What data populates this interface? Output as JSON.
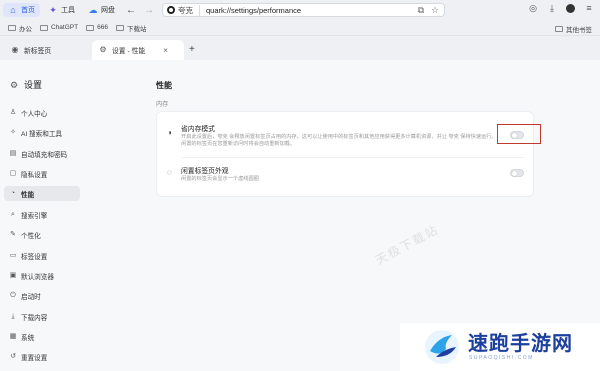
{
  "topbar": {
    "tabs": [
      {
        "label": "首页",
        "icon": "home-icon",
        "active": true
      },
      {
        "label": "工具",
        "icon": "sparkle-icon",
        "active": false
      },
      {
        "label": "网盘",
        "icon": "cloud-icon",
        "active": false
      }
    ],
    "search_engine": "夸克",
    "url": "quark://settings/performance"
  },
  "bookmarks": {
    "items": [
      "办公",
      "ChatGPT",
      "666",
      "下载站"
    ],
    "other": "其他书签"
  },
  "tabs": [
    {
      "label": "新标签页",
      "active": false
    },
    {
      "label": "设置 - 性能",
      "active": true
    }
  ],
  "sidebar": {
    "title": "设置",
    "items": [
      {
        "label": "个人中心",
        "icon": "person-icon"
      },
      {
        "label": "AI 搜索和工具",
        "icon": "ai-icon"
      },
      {
        "label": "自动填充和密码",
        "icon": "autofill-icon"
      },
      {
        "label": "隐私设置",
        "icon": "privacy-icon"
      },
      {
        "label": "性能",
        "icon": "performance-icon",
        "active": true
      },
      {
        "label": "搜索引擎",
        "icon": "search-icon"
      },
      {
        "label": "个性化",
        "icon": "personalize-icon"
      },
      {
        "label": "标签设置",
        "icon": "tab-icon"
      },
      {
        "label": "默认浏览器",
        "icon": "browser-icon"
      },
      {
        "label": "启动时",
        "icon": "power-icon"
      },
      {
        "label": "下载内容",
        "icon": "download-icon"
      },
      {
        "label": "系统",
        "icon": "system-icon"
      },
      {
        "label": "重置设置",
        "icon": "reset-icon"
      }
    ]
  },
  "main": {
    "title": "性能",
    "section": "内存",
    "settings": [
      {
        "name": "省内存模式",
        "desc": "开启此设置后，夸克 会释放闲置标签页占用的内存。这可以让使用中的标签页和其他应用获得更多计算机资源，并让 夸克 保持快速运行。闲置的标签页在您重新访问时将会自动重新加载。",
        "enabled": false
      },
      {
        "name": "闲置标签页外观",
        "desc": "闲置的标签页会显示一个虚线圆圈",
        "enabled": false
      }
    ]
  },
  "watermark": "天极下载站",
  "brand": {
    "name": "速跑手游网",
    "sub": "SUPAOQISHI.COM",
    "color": "#1d3f9e"
  }
}
